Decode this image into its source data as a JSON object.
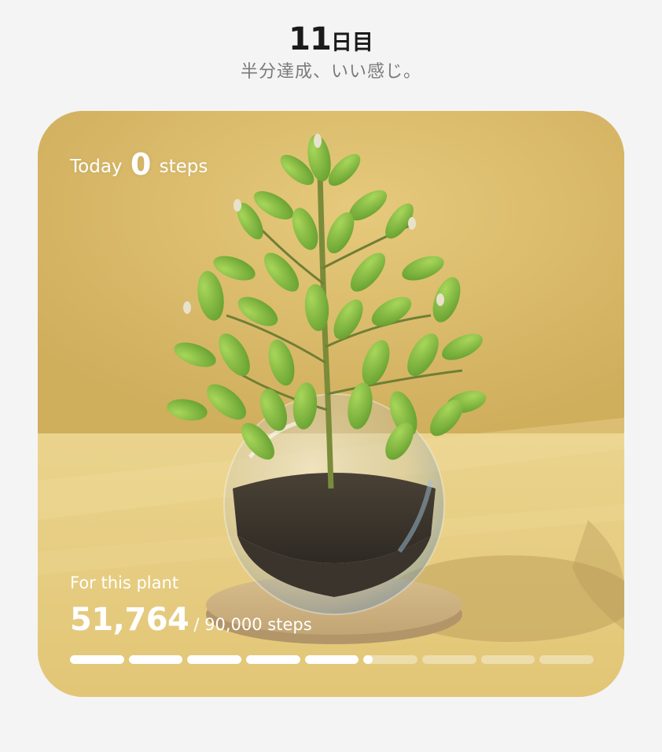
{
  "header": {
    "day_number": "11",
    "day_suffix": "日目",
    "subtitle": "半分達成、いい感じ。"
  },
  "card": {
    "today": {
      "prefix": "Today",
      "count": "0",
      "suffix": "steps"
    },
    "plant_label": "For this plant",
    "plant_steps": "51,764",
    "plant_goal": "/ 90,000 steps",
    "progress_fraction": 0.575,
    "segment_count": 9,
    "image": "plant-in-glass-bowl"
  },
  "colors": {
    "background": "#f4f4f4",
    "card_bg": "#dcbf6f",
    "text_light": "#ffffff",
    "title_text": "#1a1a1a",
    "subtitle_text": "#7a7a7a"
  }
}
